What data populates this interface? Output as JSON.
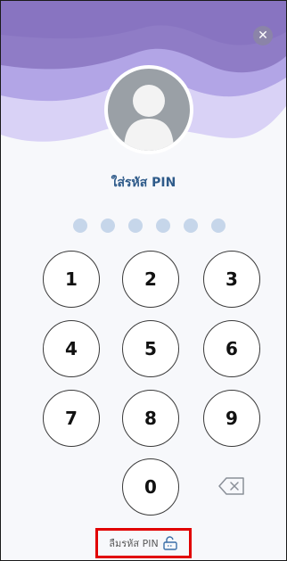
{
  "screen": {
    "title": "ใส่รหัส PIN",
    "pin_length": 6,
    "entered_digits": 0
  },
  "header": {
    "close_icon": "close-icon",
    "avatar": "avatar"
  },
  "keypad": {
    "keys": [
      "1",
      "2",
      "3",
      "4",
      "5",
      "6",
      "7",
      "8",
      "9",
      "0"
    ],
    "backspace_icon": "backspace-icon"
  },
  "footer": {
    "forgot_label": "ลืมรหัส PIN",
    "forgot_icon": "unlock-icon"
  },
  "colors": {
    "accent": "#2f5b8a",
    "dots": "#c6d6ea",
    "wave_purple": "#8f7cc6",
    "wave_light": "#cfc6f3",
    "highlight_red": "#e10000"
  }
}
